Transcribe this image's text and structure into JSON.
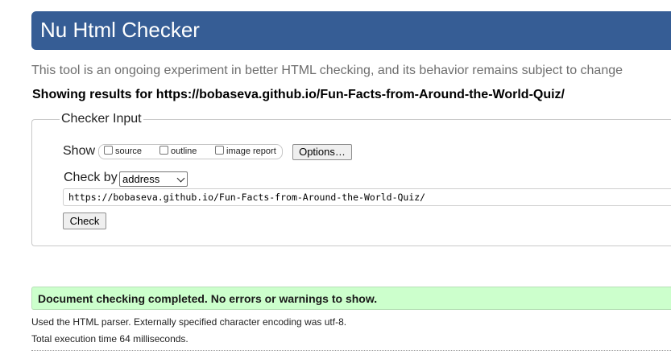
{
  "header": {
    "title": "Nu Html Checker",
    "tagline": "This tool is an ongoing experiment in better HTML checking, and its behavior remains subject to change",
    "results_heading": "Showing results for https://bobaseva.github.io/Fun-Facts-from-Around-the-World-Quiz/",
    "banner_color": "#365d95"
  },
  "checker_input": {
    "legend": "Checker Input",
    "show_label": "Show",
    "options": [
      {
        "label": "source",
        "checked": false
      },
      {
        "label": "outline",
        "checked": false
      },
      {
        "label": "image report",
        "checked": false
      }
    ],
    "options_button": "Options…",
    "check_by_label": "Check by",
    "check_by_selected": "address",
    "url_value": "https://bobaseva.github.io/Fun-Facts-from-Around-the-World-Quiz/",
    "check_button": "Check"
  },
  "results": {
    "success_message": "Document checking completed. No errors or warnings to show.",
    "success_color": "#ccffcc",
    "parser_info": "Used the HTML parser. Externally specified character encoding was utf-8.",
    "execution_time": "Total execution time 64 milliseconds."
  }
}
